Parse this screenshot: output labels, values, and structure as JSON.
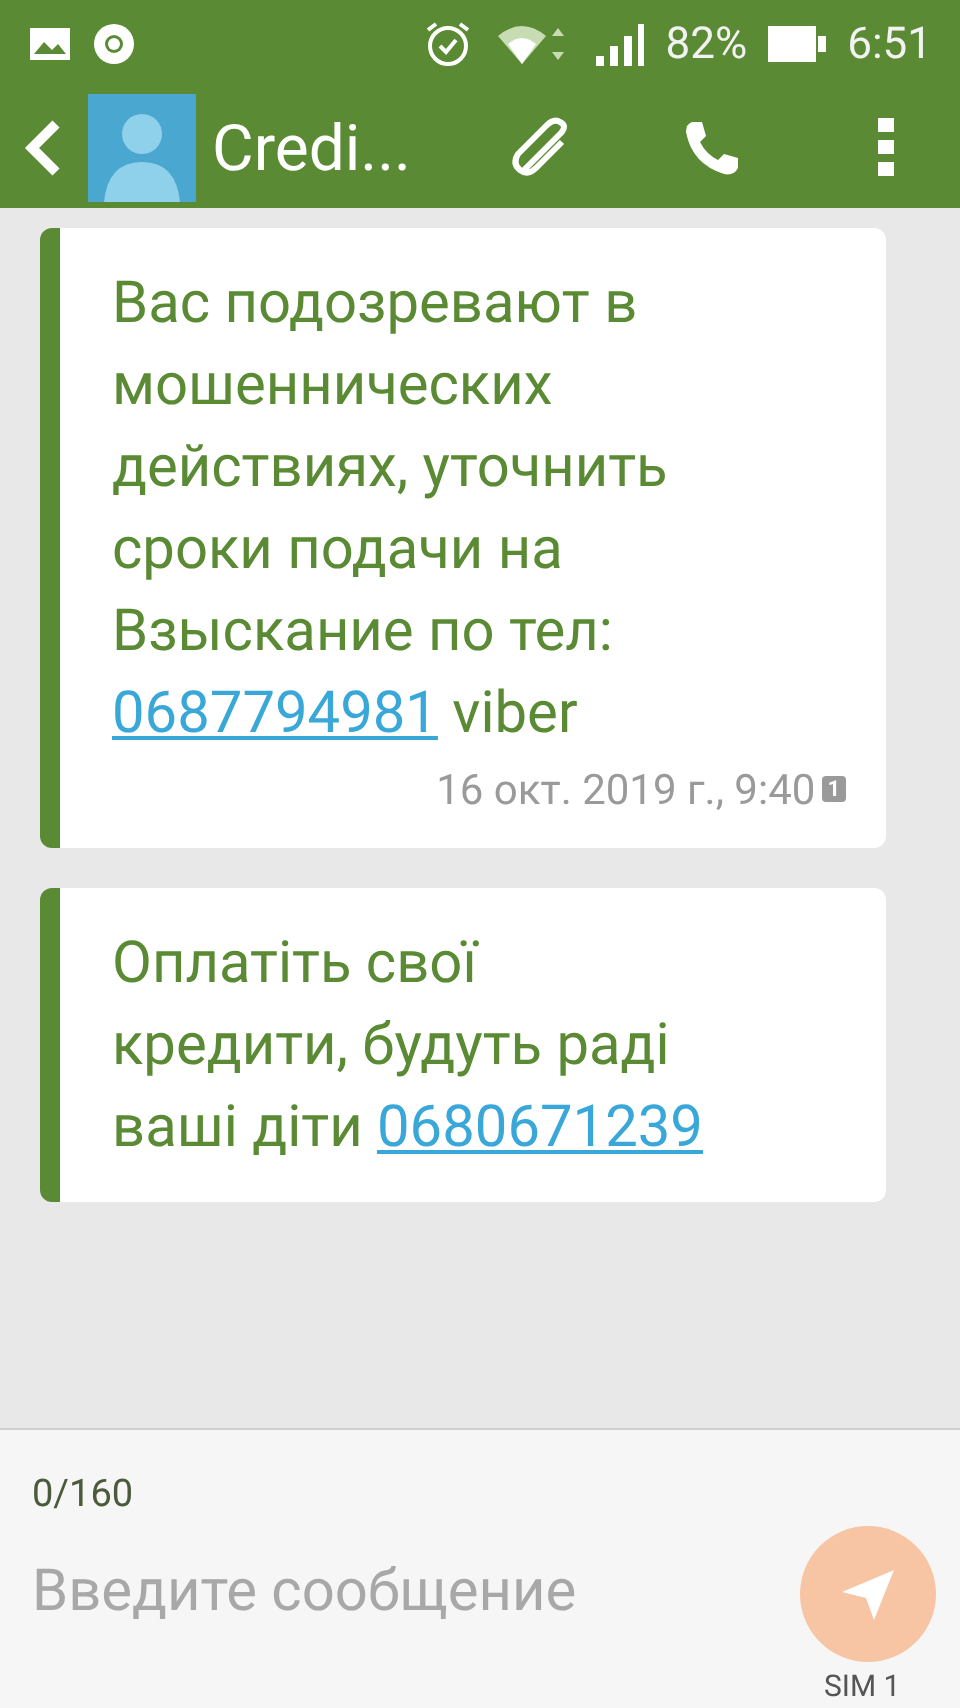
{
  "status_bar": {
    "battery": "82%",
    "time": "6:51"
  },
  "toolbar": {
    "contact": "Credi..."
  },
  "messages": [
    {
      "parts": [
        {
          "kind": "text",
          "text": "Вас подозревают в мошеннических действиях, уточнить сроки подачи на Взыскание по тел: "
        },
        {
          "kind": "link",
          "text": "0687794981"
        },
        {
          "kind": "text",
          "text": " viber"
        }
      ],
      "timestamp": "16 окт. 2019 г., 9:40",
      "sim_badge": "1"
    },
    {
      "parts": [
        {
          "kind": "text",
          "text": "Оплатіть свої кредити, будуть раді ваші діти "
        },
        {
          "kind": "link",
          "text": "0680671239"
        }
      ]
    }
  ],
  "composer": {
    "counter": "0/160",
    "placeholder": "Введите сообщение",
    "sim_label": "SIM 1"
  }
}
